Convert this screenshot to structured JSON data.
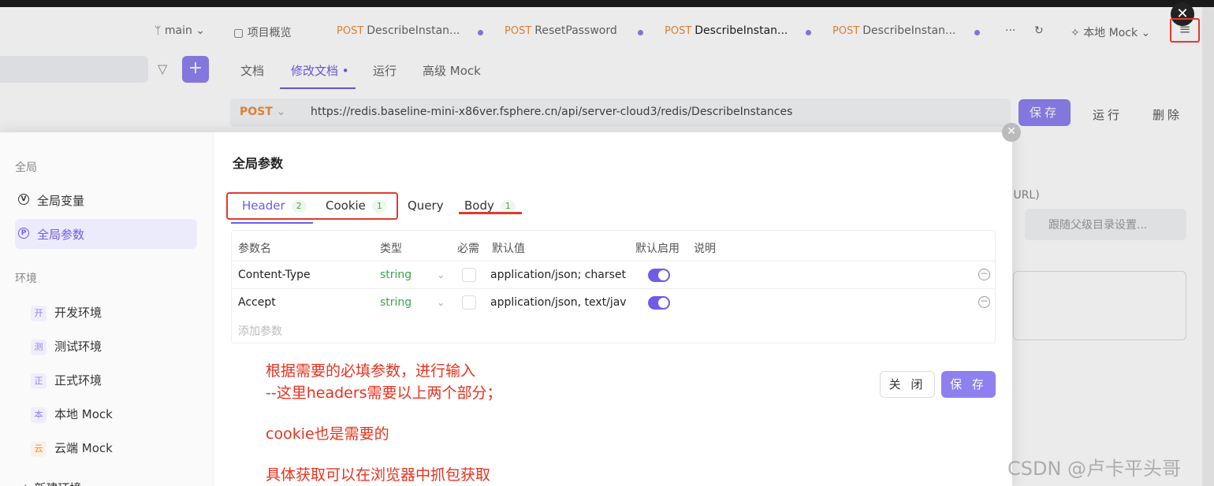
{
  "top": {
    "branch": "main",
    "overview": "项目概览",
    "tabs": [
      {
        "method": "POST",
        "label": "DescribeInstan..."
      },
      {
        "method": "POST",
        "label": "ResetPassword"
      },
      {
        "method": "POST",
        "label": "DescribeInstan..."
      },
      {
        "method": "POST",
        "label": "DescribeInstan..."
      }
    ],
    "more": "···",
    "env_select": "本地 Mock",
    "close": "✕",
    "menu": "≡"
  },
  "subtabs": [
    "文档",
    "修改文档 •",
    "运行",
    "高级 Mock"
  ],
  "urlbar": {
    "method": "POST",
    "url": "https://redis.baseline-mini-x86ver.fsphere.cn/api/server-cloud3/redis/DescribeInstances"
  },
  "actions": {
    "save": "保存",
    "run": "运行",
    "delete": "删除"
  },
  "bg_right": {
    "url_label": "(URL)",
    "follow": "跟随父级目录设置..."
  },
  "modal": {
    "close": "✕",
    "nav": {
      "global_section": "全局",
      "global_vars": "全局变量",
      "global_params": "全局参数",
      "env_section": "环境",
      "envs": [
        {
          "badge": "开",
          "label": "开发环境",
          "color": "#8f80f0"
        },
        {
          "badge": "测",
          "label": "测试环境",
          "color": "#8f80f0"
        },
        {
          "badge": "正",
          "label": "正式环境",
          "color": "#8f80f0"
        },
        {
          "badge": "本",
          "label": "本地 Mock",
          "color": "#8f80f0"
        },
        {
          "badge": "云",
          "label": "云端 Mock",
          "color": "#f08a3c"
        }
      ],
      "new_env": "+ 新建环境"
    },
    "title": "全局参数",
    "tabs": [
      {
        "label": "Header",
        "count": "2"
      },
      {
        "label": "Cookie",
        "count": "1"
      },
      {
        "label": "Query",
        "count": ""
      },
      {
        "label": "Body",
        "count": "1"
      }
    ],
    "table": {
      "headers": [
        "参数名",
        "类型",
        "必需",
        "默认值",
        "默认启用",
        "说明"
      ],
      "rows": [
        {
          "name": "Content-Type",
          "type": "string",
          "default": "application/json; charset="
        },
        {
          "name": "Accept",
          "type": "string",
          "default": "application/json, text/java"
        }
      ],
      "add": "添加参数"
    },
    "close_btn": "关 闭",
    "save_btn": "保 存"
  },
  "annotation": {
    "line1": "根据需要的必填参数，进行输入",
    "line2": "--这里headers需要以上两个部分；",
    "line3": "cookie也是需要的",
    "line4": "具体获取可以在浏览器中抓包获取"
  },
  "watermark": "CSDN @卢卡平头哥"
}
